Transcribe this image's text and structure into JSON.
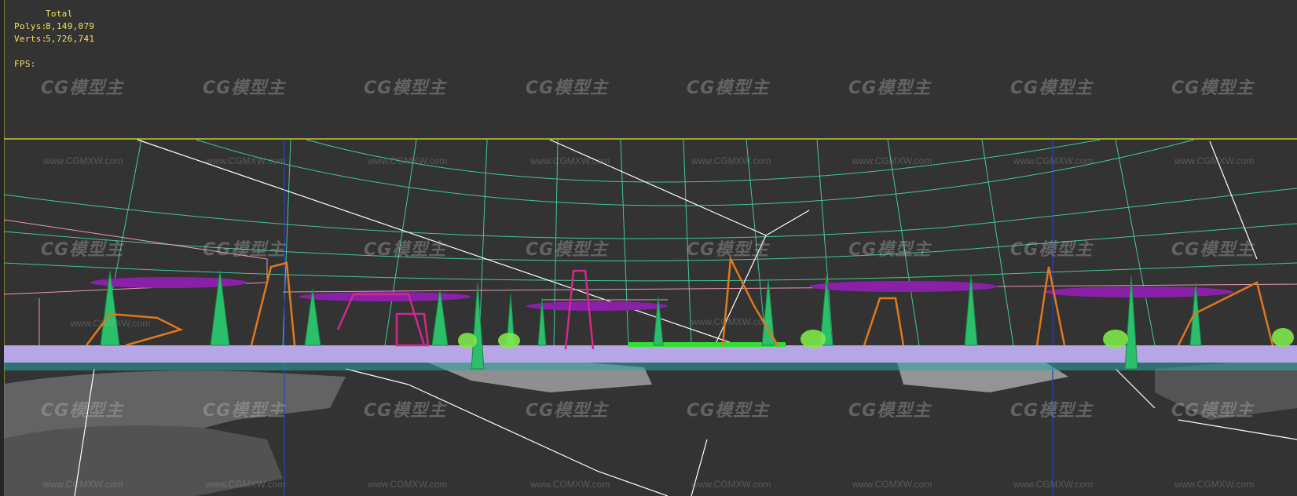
{
  "viewport": {
    "stats": {
      "heading": "Total",
      "polys_label": "Polys:",
      "polys_value": "8,149,079",
      "verts_label": "Verts:",
      "verts_value": "5,726,741",
      "fps_label": "FPS:"
    },
    "watermark": {
      "logo_text": "CG模型主",
      "url_text": "www.CGMXW.com"
    },
    "colors": {
      "background": "#333333",
      "text": "#f2e35c",
      "frame": "#c8c830",
      "grid": "#45d6a8",
      "crane": "#e0781e",
      "tower": "#2bbf6a",
      "dock": "#b6a6e6",
      "magenta": "#d02a8c",
      "purple": "#8a1fa8",
      "ground": "#8a8a8a"
    }
  }
}
